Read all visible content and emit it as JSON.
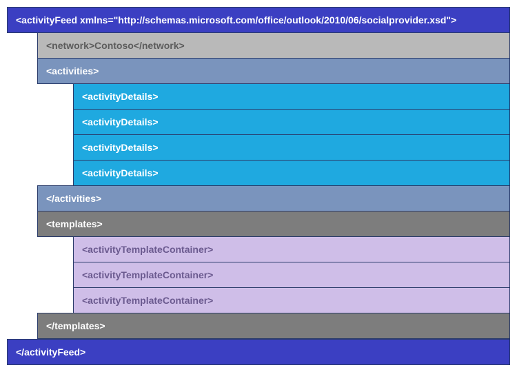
{
  "rootOpen": "<activityFeed xmlns=\"http://schemas.microsoft.com/office/outlook/2010/06/socialprovider.xsd\">",
  "network": "<network>Contoso</network>",
  "activitiesOpen": "<activities>",
  "activityDetails": [
    "<activityDetails>",
    "<activityDetails>",
    "<activityDetails>",
    "<activityDetails>"
  ],
  "activitiesClose": "</activities>",
  "templatesOpen": "<templates>",
  "templateContainers": [
    "<activityTemplateContainer>",
    "<activityTemplateContainer>",
    "<activityTemplateContainer>"
  ],
  "templatesClose": "</templates>",
  "rootClose": "</activityFeed>"
}
